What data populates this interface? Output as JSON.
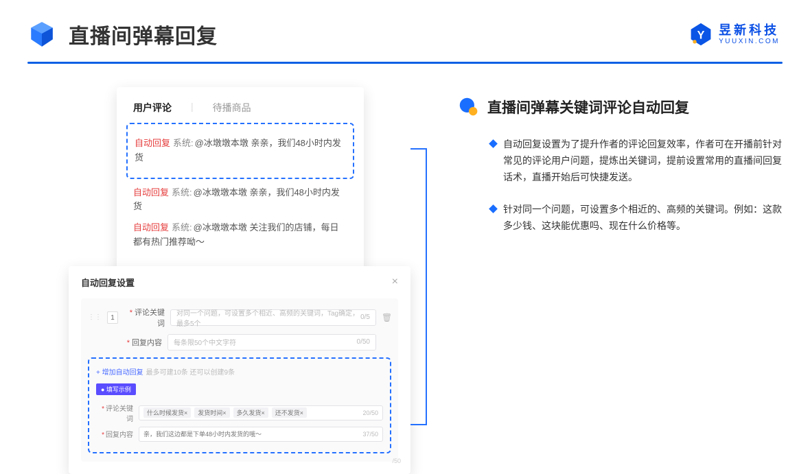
{
  "header": {
    "title": "直播间弹幕回复"
  },
  "logo": {
    "cn": "昱新科技",
    "en": "YUUXIN.COM"
  },
  "commentsPanel": {
    "tabActive": "用户评论",
    "tabInactive": "待播商品",
    "highlighted": {
      "tag": "自动回复",
      "sys": "系统:",
      "text": "@冰墩墩本墩 亲亲，我们48小时内发货"
    },
    "items": [
      {
        "tag": "自动回复",
        "sys": "系统:",
        "text": "@冰墩墩本墩 亲亲，我们48小时内发货"
      },
      {
        "tag": "自动回复",
        "sys": "系统:",
        "text": "@冰墩墩本墩 关注我们的店铺，每日都有热门推荐呦～"
      }
    ]
  },
  "settings": {
    "title": "自动回复设置",
    "ordinal": "1",
    "keywordLabel": "评论关键词",
    "keywordPlaceholder": "对同一个问题，可设置多个相近、高频的关键词，Tag确定，最多5个",
    "keywordCount": "0/5",
    "replyLabel": "回复内容",
    "replyPlaceholder": "每条限50个中文字符",
    "replyCount": "0/50",
    "addLink": "+ 增加自动回复",
    "addHint": "最多可建10条 还可以创建9条",
    "exampleBadge": "● 填写示例",
    "ex": {
      "keywordLabel": "评论关键词",
      "chips": [
        "什么时候发货×",
        "发货时间×",
        "多久发货×",
        "还不发货×"
      ],
      "chipsCount": "20/50",
      "replyLabel": "回复内容",
      "replyText": "亲，我们这边都是下单48小时内发货的哦～",
      "replyCount": "37/50"
    },
    "ghostCount": "/50"
  },
  "right": {
    "title": "直播间弹幕关键词评论自动回复",
    "bullets": [
      "自动回复设置为了提升作者的评论回复效率，作者可在开播前针对常见的评论用户问题，提炼出关键词，提前设置常用的直播间回复话术，直播开始后可快捷发送。",
      "针对同一个问题，可设置多个相近的、高频的关键词。例如：这款多少钱、这块能优惠吗、现在什么价格等。"
    ]
  }
}
